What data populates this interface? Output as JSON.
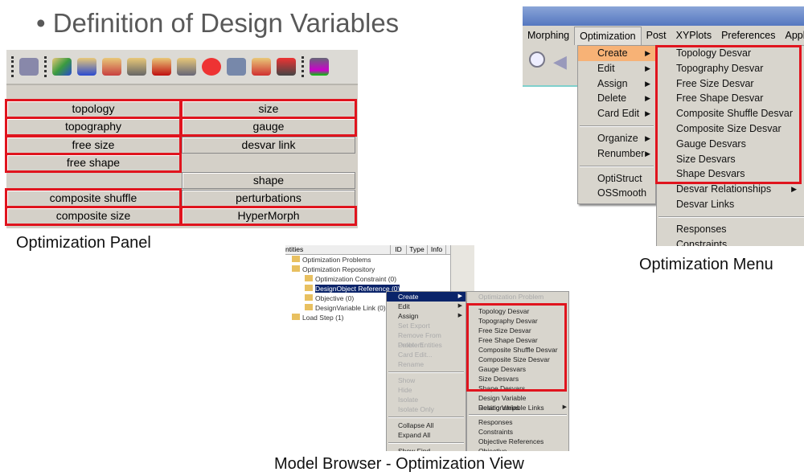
{
  "title": "• Definition of Design Variables",
  "panel": {
    "caption": "Optimization Panel",
    "left": [
      "topology",
      "topography",
      "free size",
      "free shape",
      "",
      "composite shuffle",
      "composite size"
    ],
    "right": [
      "size",
      "gauge",
      "desvar link",
      "",
      "shape",
      "perturbations",
      "HyperMorph"
    ],
    "left_highlighted": [
      true,
      true,
      true,
      true,
      false,
      true,
      true
    ],
    "right_highlighted": [
      true,
      true,
      false,
      false,
      false,
      false,
      true
    ]
  },
  "menu": {
    "caption": "Optimization Menu",
    "menubar": [
      "Morphing",
      "Optimization",
      "Post",
      "XYPlots",
      "Preferences",
      "Appli"
    ],
    "dropdown": [
      "Create",
      "Edit",
      "Assign",
      "Delete",
      "Card Edit",
      "Organize",
      "Renumber",
      "OptiStruct",
      "OSSmooth"
    ],
    "submenu": [
      "Topology Desvar",
      "Topography Desvar",
      "Free Size Desvar",
      "Free Shape Desvar",
      "Composite Shuffle Desvar",
      "Composite Size Desvar",
      "Gauge Desvars",
      "Size Desvars",
      "Shape Desvars",
      "Desvar Relationships",
      "Desvar Links",
      "Responses",
      "Constraints"
    ],
    "highlight_color": "#e0141e"
  },
  "browser": {
    "caption": "Model Browser - Optimization View",
    "columns": [
      "ntities",
      "ID",
      "Type",
      "Info"
    ],
    "tree": [
      "Optimization Problems",
      "Optimization Repository",
      "Optimization Constraint (0)",
      "DesignObject Reference (0)",
      "Objective (0)",
      "DesignVariable Link (0)",
      "Load Step (1)"
    ],
    "context": [
      "Create",
      "Edit",
      "Assign",
      "Set Export",
      "Remove From Problem",
      "Delete Entities",
      "Card Edit...",
      "Rename",
      "Show",
      "Hide",
      "Isolate",
      "Isolate Only",
      "Collapse All",
      "Expand All",
      "Show Find"
    ],
    "submenu": [
      "Optimization Problem",
      "Topology Desvar",
      "Topography Desvar",
      "Free Size Desvar",
      "Free Shape Desvar",
      "Composite Shuffle Desvar",
      "Composite Size Desvar",
      "Gauge Desvars",
      "Size Desvars",
      "Shape Desvars",
      "Design Variable Relationships",
      "Desing Variable Links",
      "Responses",
      "Constraints",
      "Objective References",
      "Objective"
    ]
  }
}
